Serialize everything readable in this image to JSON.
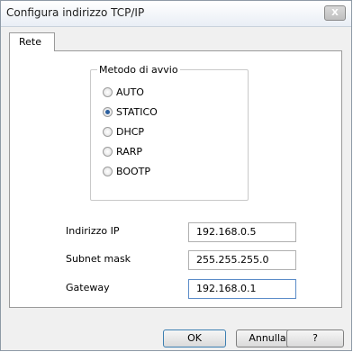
{
  "window": {
    "title": "Configura indirizzo TCP/IP",
    "close_label": "X"
  },
  "tabs": [
    {
      "label": "Rete",
      "active": true
    }
  ],
  "boot_method": {
    "legend": "Metodo di avvio",
    "options": [
      {
        "label": "AUTO",
        "checked": false
      },
      {
        "label": "STATICO",
        "checked": true
      },
      {
        "label": "DHCP",
        "checked": false
      },
      {
        "label": "RARP",
        "checked": false
      },
      {
        "label": "BOOTP",
        "checked": false
      }
    ]
  },
  "fields": {
    "ip": {
      "label": "Indirizzo IP",
      "value": "192.168.0.5"
    },
    "subnet": {
      "label": "Subnet mask",
      "value": "255.255.255.0"
    },
    "gateway": {
      "label": "Gateway",
      "value": "192.168.0.1"
    }
  },
  "buttons": {
    "ok": "OK",
    "cancel": "Annulla",
    "help": "?"
  },
  "colors": {
    "accent": "#2b5f9e",
    "close_button": "#bfbfbf"
  }
}
